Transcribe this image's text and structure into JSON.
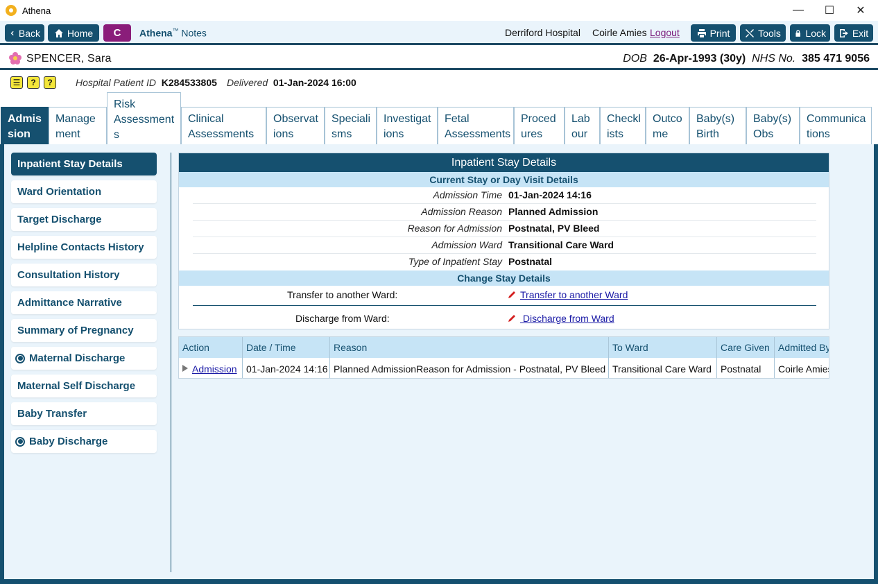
{
  "window": {
    "title": "Athena"
  },
  "toolbar": {
    "back": "Back",
    "home": "Home",
    "c_badge": "C",
    "brand_name": "Athena",
    "brand_tm": "™",
    "brand_suffix": "Notes",
    "hospital": "Derriford Hospital",
    "user": "Coirle Amies",
    "logout": "Logout",
    "print": "Print",
    "tools": "Tools",
    "lock": "Lock",
    "exit": "Exit"
  },
  "patient": {
    "name": "SPENCER, Sara",
    "dob_label": "DOB",
    "dob": "26-Apr-1993 (30y)",
    "nhs_label": "NHS No.",
    "nhs": "385 471 9056",
    "hospital_id_label": "Hospital Patient ID",
    "hospital_id": "K284533805",
    "delivered_label": "Delivered",
    "delivered": "01-Jan-2024 16:00"
  },
  "tabs": [
    {
      "l1": "Admis",
      "l2": "sion"
    },
    {
      "l1": "Manage",
      "l2": "ment"
    },
    {
      "l1": "Risk",
      "l2": "Assessment",
      "l3": "s"
    },
    {
      "l1": "Clinical",
      "l2": "Assessments"
    },
    {
      "l1": "Observat",
      "l2": "ions"
    },
    {
      "l1": "Speciali",
      "l2": "sms"
    },
    {
      "l1": "Investigat",
      "l2": "ions"
    },
    {
      "l1": "Fetal",
      "l2": "Assessments"
    },
    {
      "l1": "Proced",
      "l2": "ures"
    },
    {
      "l1": "Lab",
      "l2": "our"
    },
    {
      "l1": "Checkl",
      "l2": "ists"
    },
    {
      "l1": "Outco",
      "l2": "me"
    },
    {
      "l1": "Baby(s)",
      "l2": "Birth"
    },
    {
      "l1": "Baby(s)",
      "l2": "Obs"
    },
    {
      "l1": "Communica",
      "l2": "tions"
    }
  ],
  "side_menu": [
    "Inpatient Stay Details",
    "Ward Orientation",
    "Target Discharge",
    "Helpline Contacts History",
    "Consultation History",
    "Admittance Narrative",
    "Summary of Pregnancy",
    "Maternal Discharge",
    "Maternal Self Discharge",
    "Baby Transfer",
    "Baby Discharge"
  ],
  "details": {
    "title": "Inpatient Stay Details",
    "current_heading": "Current Stay or Day Visit Details",
    "rows": [
      {
        "label": "Admission Time",
        "value": "01-Jan-2024 14:16"
      },
      {
        "label": "Admission Reason",
        "value": "Planned Admission"
      },
      {
        "label": "Reason for Admission",
        "value": "Postnatal, PV Bleed"
      },
      {
        "label": "Admission Ward",
        "value": "Transitional Care Ward"
      },
      {
        "label": "Type of Inpatient Stay",
        "value": "Postnatal"
      }
    ],
    "change_heading": "Change Stay Details",
    "transfer_label": "Transfer to another Ward:",
    "transfer_link": "Transfer to another Ward",
    "discharge_label": "Discharge from Ward:",
    "discharge_link": " Discharge from Ward"
  },
  "history": {
    "headers": [
      "Action",
      "Date / Time",
      "Reason",
      "To Ward",
      "Care Given",
      "Admitted By"
    ],
    "row": {
      "action": "Admission",
      "datetime": "01-Jan-2024 14:16",
      "reason": "Planned AdmissionReason for Admission - Postnatal, PV Bleed",
      "to_ward": "Transitional Care Ward",
      "care_given": "Postnatal",
      "admitted_by": "Coirle Amies"
    }
  }
}
